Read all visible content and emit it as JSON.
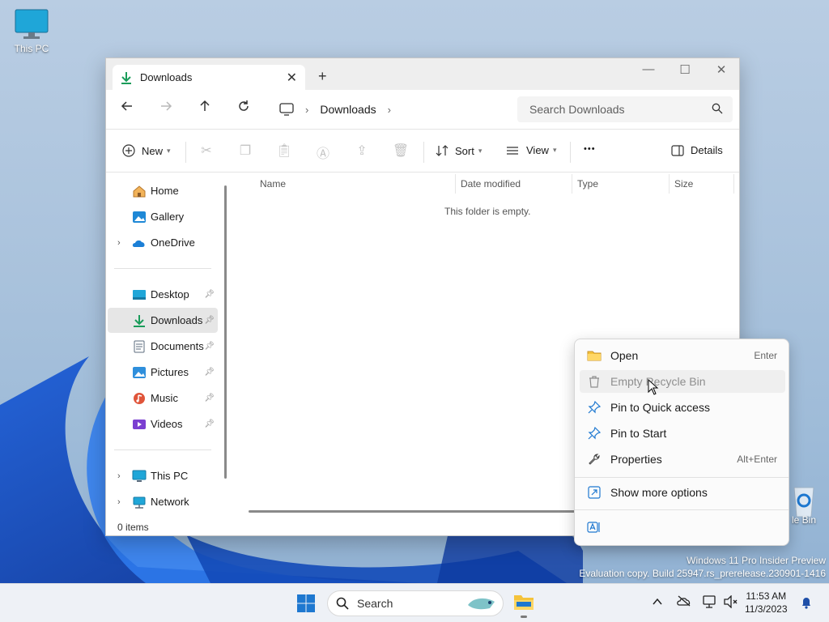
{
  "desktop": {
    "icons": [
      {
        "label": "This PC"
      },
      {
        "label": "le Bin"
      }
    ],
    "watermark": {
      "line1": "Windows 11 Pro Insider Preview",
      "line2": "Evaluation copy. Build 25947.rs_prerelease.230901-1416"
    }
  },
  "window": {
    "tab_title": "Downloads",
    "tab_close": "✕",
    "new_tab": "+",
    "controls": {
      "minimize": "—",
      "maximize": "☐",
      "close": "✕"
    },
    "breadcrumb": [
      "Downloads"
    ],
    "search_placeholder": "Search Downloads",
    "toolbar": {
      "new_label": "New",
      "sort_label": "Sort",
      "view_label": "View",
      "more_label": "•••",
      "details_label": "Details"
    },
    "nav": {
      "quick": [
        {
          "label": "Home",
          "icon": "home-icon"
        },
        {
          "label": "Gallery",
          "icon": "gallery-icon"
        },
        {
          "label": "OneDrive",
          "icon": "onedrive-icon"
        }
      ],
      "pinned": [
        {
          "label": "Desktop",
          "icon": "desktop-folder-icon"
        },
        {
          "label": "Downloads",
          "icon": "downloads-folder-icon",
          "selected": true
        },
        {
          "label": "Documents",
          "icon": "documents-folder-icon"
        },
        {
          "label": "Pictures",
          "icon": "pictures-folder-icon"
        },
        {
          "label": "Music",
          "icon": "music-folder-icon"
        },
        {
          "label": "Videos",
          "icon": "videos-folder-icon"
        }
      ],
      "devices": [
        {
          "label": "This PC",
          "icon": "this-pc-icon"
        },
        {
          "label": "Network",
          "icon": "network-icon"
        }
      ]
    },
    "columns": [
      "Name",
      "Date modified",
      "Type",
      "Size"
    ],
    "empty_message": "This folder is empty.",
    "status": "0 items"
  },
  "context_menu": {
    "items": [
      {
        "label": "Open",
        "accel": "Enter",
        "icon": "folder-open-icon"
      },
      {
        "label": "Empty Recycle Bin",
        "accel": "",
        "icon": "trash-icon",
        "disabled": true
      },
      {
        "label": "Pin to Quick access",
        "accel": "",
        "icon": "pin-icon"
      },
      {
        "label": "Pin to Start",
        "accel": "",
        "icon": "pin-icon"
      },
      {
        "label": "Properties",
        "accel": "Alt+Enter",
        "icon": "wrench-icon"
      },
      {
        "label": "Show more options",
        "accel": "",
        "icon": "more-options-icon"
      }
    ]
  },
  "taskbar": {
    "search_label": "Search",
    "time": "11:53 AM",
    "date": "11/3/2023"
  },
  "colors": {
    "accent": "#0067c0",
    "downloads_green": "#1a9c5a",
    "folder_yellow": "#f5c33b"
  }
}
